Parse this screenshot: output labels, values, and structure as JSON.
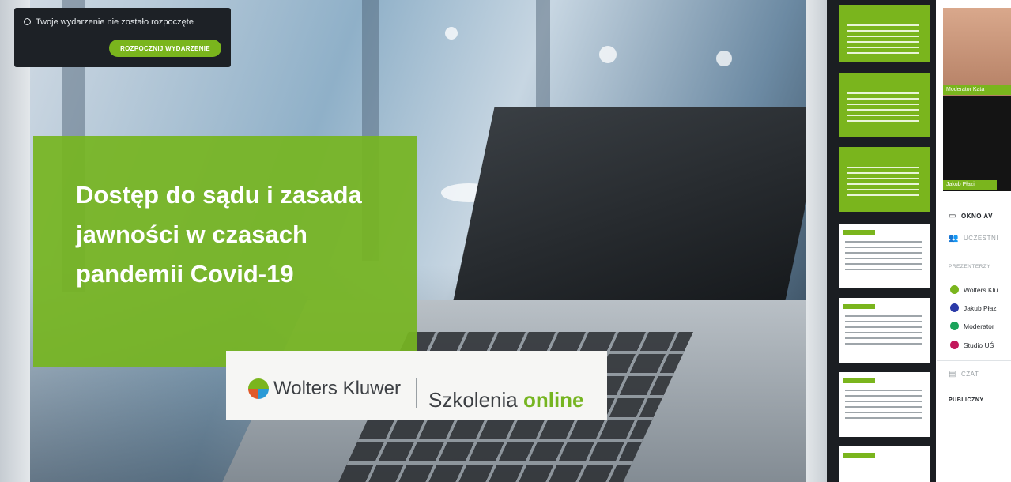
{
  "event_banner": {
    "status_text": "Twoje wydarzenie nie zostało rozpoczęte",
    "start_button_label": "ROZPOCZNIJ WYDARZENIE"
  },
  "slide": {
    "title": "Dostęp do sądu i zasada jawności w czasach pandemii Covid-19",
    "brand_name": "Wolters Kluwer",
    "brand_sub_prefix": "Szkolenia",
    "brand_sub_accent": "online"
  },
  "video_feeds": [
    {
      "label": "Moderator Kata"
    },
    {
      "label": "Jakub Płazi"
    }
  ],
  "sidebar": {
    "av_window": "OKNO AV",
    "participants": "UCZESTNI",
    "presenters_heading": "PREZENTERZY",
    "presenters": [
      {
        "name": "Wolters Klu",
        "color": "#7ab51d"
      },
      {
        "name": "Jakub Płaz",
        "color": "#2b3aa8"
      },
      {
        "name": "Moderator",
        "color": "#1aa35a"
      },
      {
        "name": "Studio UŚ",
        "color": "#c2185b"
      }
    ],
    "chat": "CZAT",
    "chat_tab": "PUBLICZNY"
  },
  "colors": {
    "brand_green": "#7ab51d",
    "dark_panel": "#1d2126"
  }
}
